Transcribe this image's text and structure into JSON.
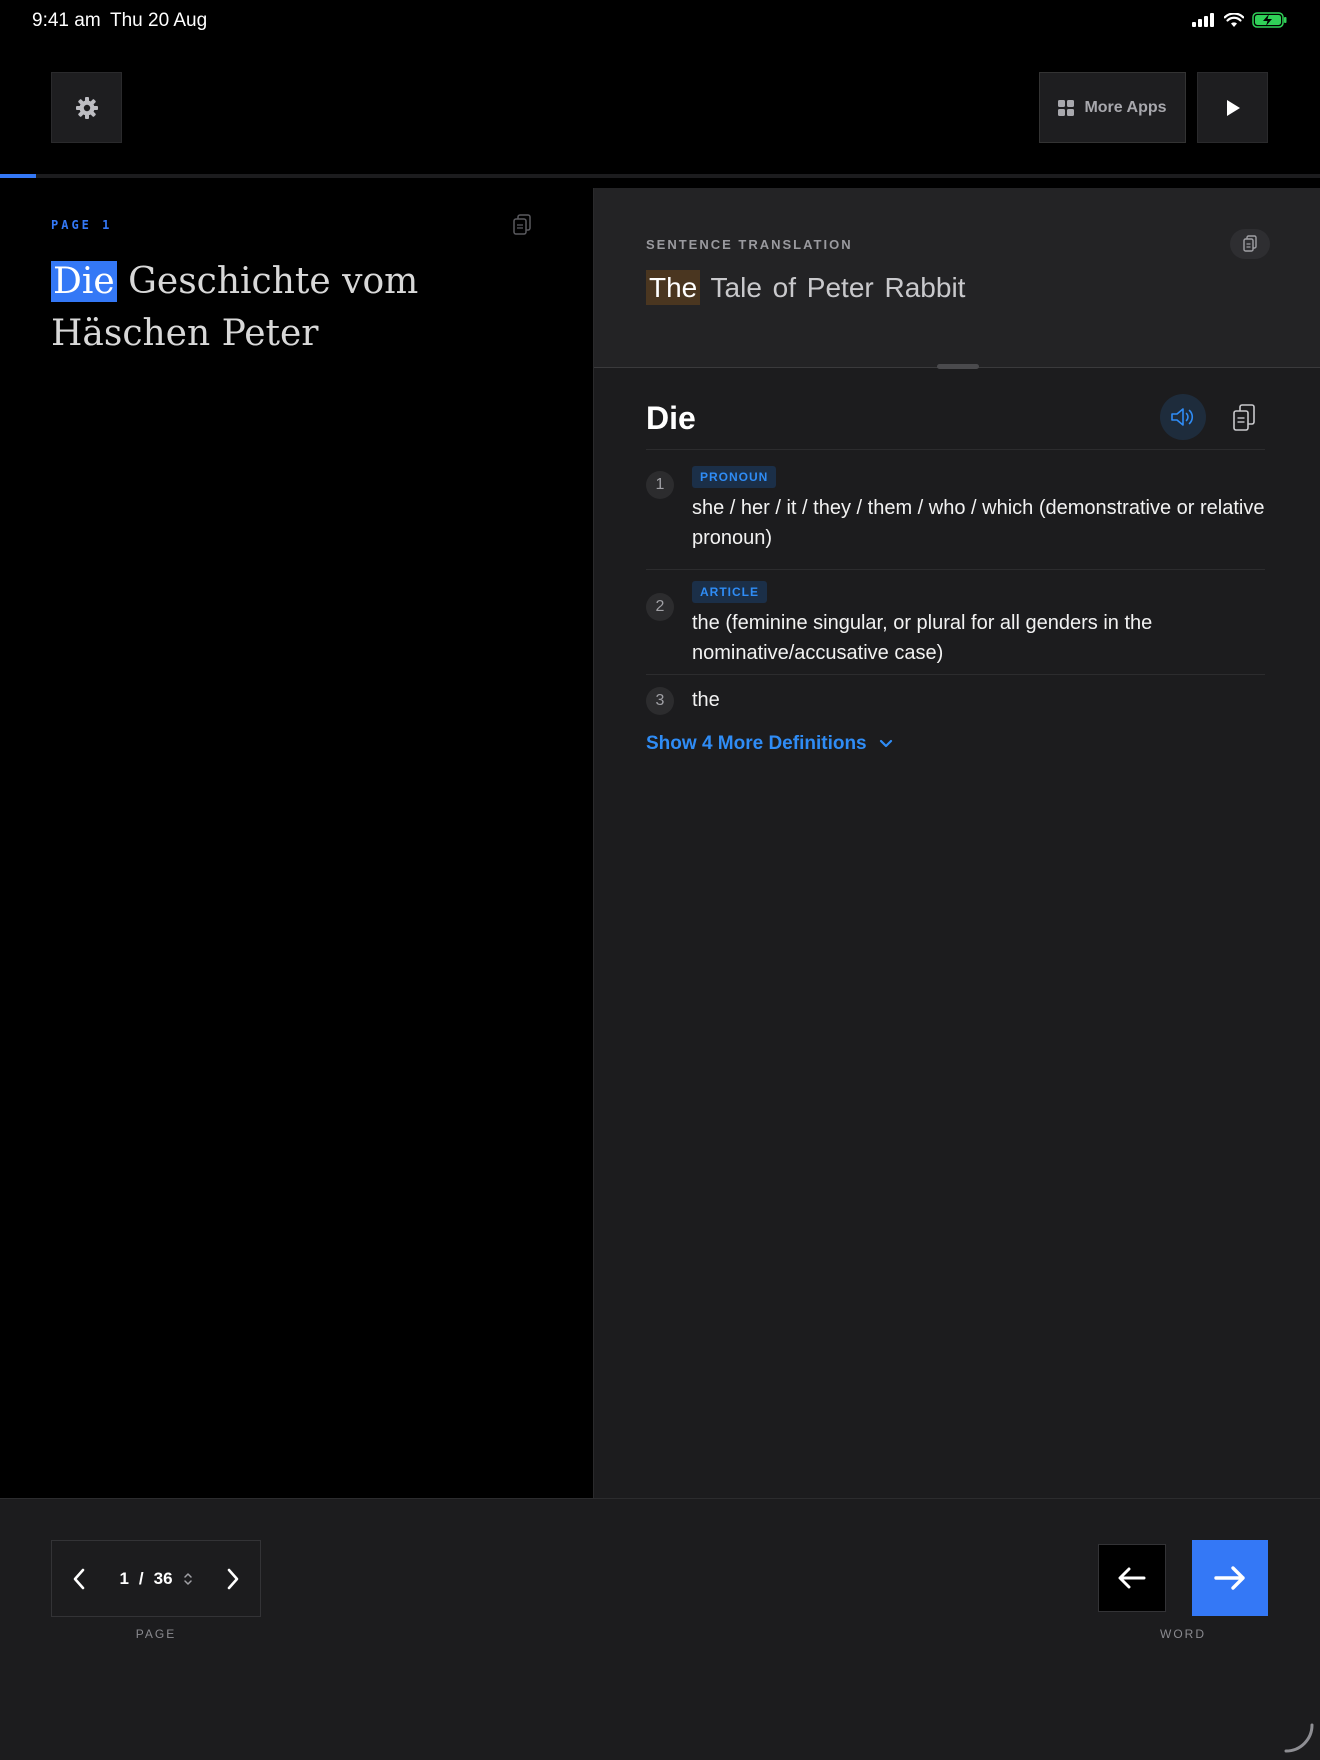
{
  "status_bar": {
    "time": "9:41 am",
    "date": "Thu 20 Aug"
  },
  "toolbar": {
    "more_apps_label": "More Apps",
    "settings_icon": "gear-icon",
    "play_icon": "play-icon"
  },
  "reading_progress": 0.027,
  "source_pane": {
    "page_label": "PAGE 1",
    "highlighted_word": "Die",
    "rest_text": "Geschichte vom Häschen Peter"
  },
  "translation": {
    "label": "SENTENCE TRANSLATION",
    "highlighted_word": "The",
    "rest_text": "Tale of Peter Rabbit"
  },
  "dictionary": {
    "word": "Die",
    "definitions": [
      {
        "num": "1",
        "pos": "PRONOUN",
        "text": "she / her / it / they / them / who / which (demonstrative or relative pronoun)"
      },
      {
        "num": "2",
        "pos": "ARTICLE",
        "text": "the (feminine singular, or plural for all genders in the nominative/accusative case)"
      },
      {
        "num": "3",
        "pos": "",
        "text": "the"
      }
    ],
    "show_more_label": "Show 4 More Definitions"
  },
  "pager": {
    "current": "1",
    "separator": "/",
    "total": "36",
    "label": "PAGE"
  },
  "word_nav": {
    "label": "WORD"
  },
  "colors": {
    "accent": "#3478f6",
    "link": "#2f8cf5",
    "translation_highlight": "#4a3620",
    "panel_bg": "#1c1c1e"
  }
}
